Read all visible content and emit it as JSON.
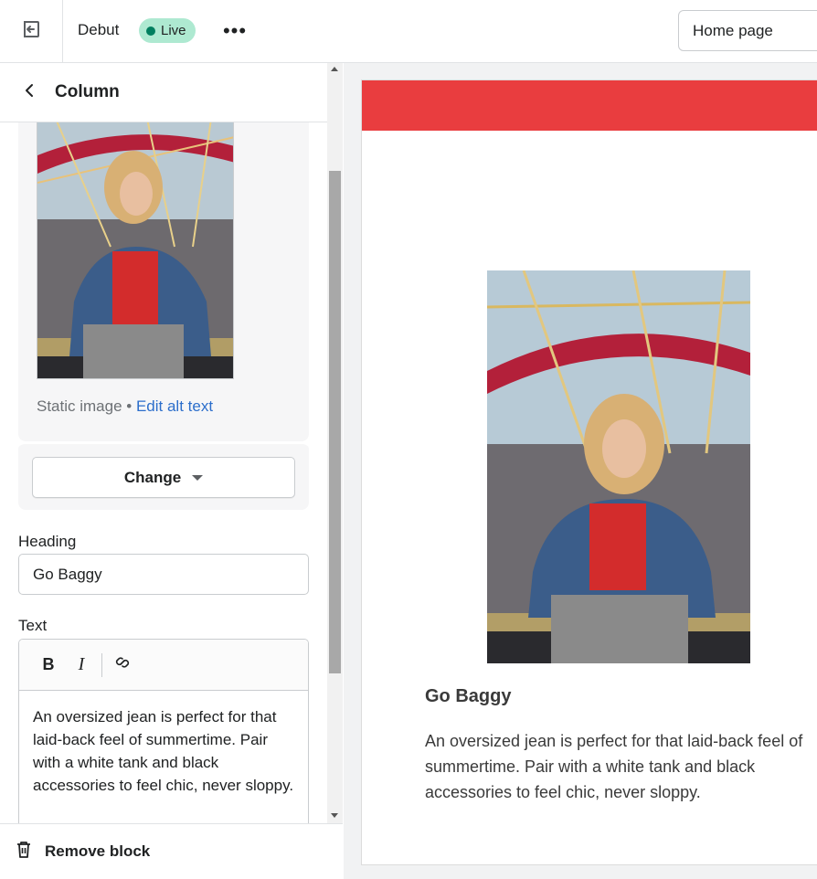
{
  "topbar": {
    "theme_name": "Debut",
    "status_badge": "Live",
    "more_label": "•••",
    "page_select": "Home page"
  },
  "sidebar": {
    "title": "Column",
    "image": {
      "meta_prefix": "Static image • ",
      "edit_alt_link": "Edit alt text",
      "change_label": "Change"
    },
    "heading_field": {
      "label": "Heading",
      "value": "Go Baggy"
    },
    "text_field": {
      "label": "Text",
      "toolbar": {
        "bold": "B",
        "italic": "I"
      },
      "value": "An oversized jean is perfect for that laid-back feel of summertime. Pair with a white tank and black accessories to feel chic, never sloppy."
    },
    "footer": {
      "remove_label": "Remove block"
    }
  },
  "preview": {
    "announcement_color": "#e93d3f",
    "heading": "Go Baggy",
    "text": "An oversized jean is perfect for that laid-back feel of summertime. Pair with a white tank and black accessories to feel chic, never sloppy."
  },
  "colors": {
    "live_badge_bg": "#aee9d1",
    "live_dot": "#007f5f",
    "link": "#2c6ecb",
    "announcement": "#e93d3f"
  }
}
